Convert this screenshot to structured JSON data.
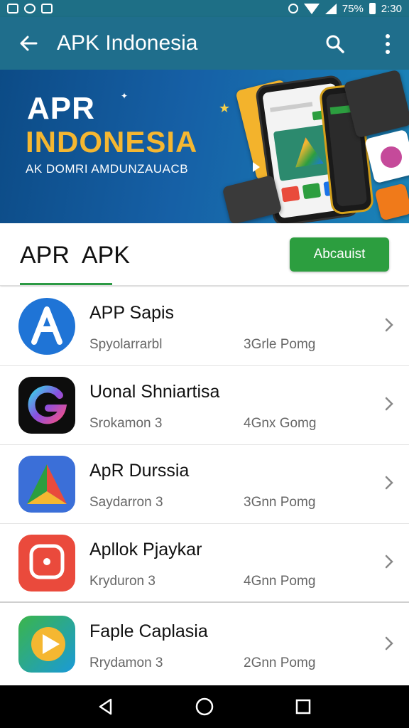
{
  "status_bar": {
    "battery": "75%",
    "time": "2:30"
  },
  "app_bar": {
    "title": "APK Indonesia",
    "back_icon": "arrow-left-icon",
    "search_icon": "search-icon",
    "more_icon": "more-vert-icon"
  },
  "banner": {
    "line1": "APR",
    "line2": "INDONESIA",
    "line3": "AK DOMRI AMDUNZAUACB"
  },
  "section": {
    "title": "APR  APK",
    "button_label": "Abcauist"
  },
  "apps": [
    {
      "name": "APP Sapis",
      "meta": "Spyolarrarbl",
      "size": "3Grle Pomg"
    },
    {
      "name": "Uonal Shniartisa",
      "meta": "Srokamon 3",
      "size": "4Gnx Gomg"
    },
    {
      "name": "ApR Durssia",
      "meta": "Saydarron 3",
      "size": "3Gnn Pomg"
    },
    {
      "name": "Apllok Pjaykar",
      "meta": "Kryduron 3",
      "size": "4Gnn Pomg"
    },
    {
      "name": "Faple Caplasia",
      "meta": "Rrydamon 3",
      "size": "2Gnn Pomg"
    }
  ],
  "colors": {
    "app_bar": "#1f6e8c",
    "accent_green": "#2c9e3f",
    "banner_yellow": "#f5b731"
  }
}
